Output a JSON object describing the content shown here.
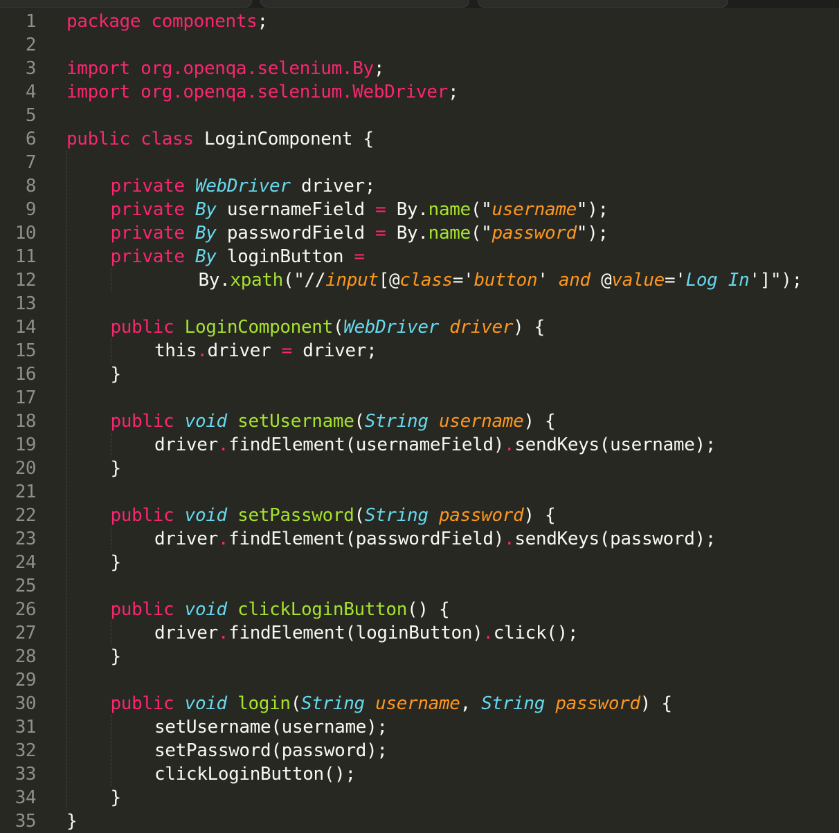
{
  "colors": {
    "background": "#272822",
    "default": "#f8f8f2",
    "keyword": "#f92672",
    "type": "#66d9ef",
    "function": "#a6e22e",
    "string": "#e6db74",
    "parameter": "#fd971f",
    "line_number": "#8f908a"
  },
  "editor": {
    "lines": [
      {
        "n": "1",
        "indent": 0,
        "tokens": [
          {
            "t": "package",
            "c": "keyword"
          },
          {
            "t": " ",
            "c": "default"
          },
          {
            "t": "components",
            "c": "keyword"
          },
          {
            "t": ";",
            "c": "default"
          }
        ]
      },
      {
        "n": "2",
        "indent": 0,
        "tokens": []
      },
      {
        "n": "3",
        "indent": 0,
        "tokens": [
          {
            "t": "import",
            "c": "keyword"
          },
          {
            "t": " ",
            "c": "default"
          },
          {
            "t": "org.openqa.selenium.By",
            "c": "keyword"
          },
          {
            "t": ";",
            "c": "default"
          }
        ]
      },
      {
        "n": "4",
        "indent": 0,
        "tokens": [
          {
            "t": "import",
            "c": "keyword"
          },
          {
            "t": " ",
            "c": "default"
          },
          {
            "t": "org.openqa.selenium.WebDriver",
            "c": "keyword"
          },
          {
            "t": ";",
            "c": "default"
          }
        ]
      },
      {
        "n": "5",
        "indent": 0,
        "tokens": []
      },
      {
        "n": "6",
        "indent": 0,
        "tokens": [
          {
            "t": "public",
            "c": "keyword"
          },
          {
            "t": " ",
            "c": "default"
          },
          {
            "t": "class",
            "c": "keyword"
          },
          {
            "t": " LoginComponent {",
            "c": "default"
          }
        ]
      },
      {
        "n": "7",
        "indent": 0,
        "tokens": []
      },
      {
        "n": "8",
        "indent": 1,
        "tokens": [
          {
            "t": "private",
            "c": "keyword"
          },
          {
            "t": " ",
            "c": "default"
          },
          {
            "t": "WebDriver",
            "c": "type",
            "i": true
          },
          {
            "t": " driver;",
            "c": "default"
          }
        ]
      },
      {
        "n": "9",
        "indent": 1,
        "tokens": [
          {
            "t": "private",
            "c": "keyword"
          },
          {
            "t": " ",
            "c": "default"
          },
          {
            "t": "By",
            "c": "type",
            "i": true
          },
          {
            "t": " usernameField ",
            "c": "default"
          },
          {
            "t": "=",
            "c": "keyword"
          },
          {
            "t": " By.",
            "c": "default"
          },
          {
            "t": "name",
            "c": "function"
          },
          {
            "t": "(\"",
            "c": "default"
          },
          {
            "t": "username",
            "c": "parameter",
            "i": true
          },
          {
            "t": "\");",
            "c": "default"
          }
        ]
      },
      {
        "n": "10",
        "indent": 1,
        "tokens": [
          {
            "t": "private",
            "c": "keyword"
          },
          {
            "t": " ",
            "c": "default"
          },
          {
            "t": "By",
            "c": "type",
            "i": true
          },
          {
            "t": " passwordField ",
            "c": "default"
          },
          {
            "t": "=",
            "c": "keyword"
          },
          {
            "t": " By.",
            "c": "default"
          },
          {
            "t": "name",
            "c": "function"
          },
          {
            "t": "(\"",
            "c": "default"
          },
          {
            "t": "password",
            "c": "parameter",
            "i": true
          },
          {
            "t": "\");",
            "c": "default"
          }
        ]
      },
      {
        "n": "11",
        "indent": 1,
        "tokens": [
          {
            "t": "private",
            "c": "keyword"
          },
          {
            "t": " ",
            "c": "default"
          },
          {
            "t": "By",
            "c": "type",
            "i": true
          },
          {
            "t": " loginButton ",
            "c": "default"
          },
          {
            "t": "=",
            "c": "keyword"
          }
        ]
      },
      {
        "n": "12",
        "indent": 3,
        "tokens": [
          {
            "t": "By.",
            "c": "default"
          },
          {
            "t": "xpath",
            "c": "function"
          },
          {
            "t": "(\"//",
            "c": "default"
          },
          {
            "t": "input",
            "c": "parameter",
            "i": true
          },
          {
            "t": "[@",
            "c": "default"
          },
          {
            "t": "class",
            "c": "parameter",
            "i": true
          },
          {
            "t": "='",
            "c": "default"
          },
          {
            "t": "button",
            "c": "parameter",
            "i": true
          },
          {
            "t": "' ",
            "c": "default"
          },
          {
            "t": "and",
            "c": "parameter",
            "i": true
          },
          {
            "t": " @",
            "c": "default"
          },
          {
            "t": "value",
            "c": "parameter",
            "i": true
          },
          {
            "t": "='",
            "c": "default"
          },
          {
            "t": "Log In",
            "c": "type",
            "i": true
          },
          {
            "t": "']\");",
            "c": "default"
          }
        ]
      },
      {
        "n": "13",
        "indent": 0,
        "tokens": []
      },
      {
        "n": "14",
        "indent": 1,
        "tokens": [
          {
            "t": "public",
            "c": "keyword"
          },
          {
            "t": " ",
            "c": "default"
          },
          {
            "t": "LoginComponent",
            "c": "function"
          },
          {
            "t": "(",
            "c": "default"
          },
          {
            "t": "WebDriver",
            "c": "type",
            "i": true
          },
          {
            "t": " ",
            "c": "default"
          },
          {
            "t": "driver",
            "c": "parameter",
            "i": true
          },
          {
            "t": ") {",
            "c": "default"
          }
        ]
      },
      {
        "n": "15",
        "indent": 2,
        "tokens": [
          {
            "t": "this",
            "c": "default"
          },
          {
            "t": ".",
            "c": "keyword"
          },
          {
            "t": "driver ",
            "c": "default"
          },
          {
            "t": "=",
            "c": "keyword"
          },
          {
            "t": " driver;",
            "c": "default"
          }
        ]
      },
      {
        "n": "16",
        "indent": 1,
        "tokens": [
          {
            "t": "}",
            "c": "default"
          }
        ]
      },
      {
        "n": "17",
        "indent": 0,
        "tokens": []
      },
      {
        "n": "18",
        "indent": 1,
        "tokens": [
          {
            "t": "public",
            "c": "keyword"
          },
          {
            "t": " ",
            "c": "default"
          },
          {
            "t": "void",
            "c": "type",
            "i": true
          },
          {
            "t": " ",
            "c": "default"
          },
          {
            "t": "setUsername",
            "c": "function"
          },
          {
            "t": "(",
            "c": "default"
          },
          {
            "t": "String",
            "c": "type",
            "i": true
          },
          {
            "t": " ",
            "c": "default"
          },
          {
            "t": "username",
            "c": "parameter",
            "i": true
          },
          {
            "t": ") {",
            "c": "default"
          }
        ]
      },
      {
        "n": "19",
        "indent": 2,
        "tokens": [
          {
            "t": "driver",
            "c": "default"
          },
          {
            "t": ".",
            "c": "keyword"
          },
          {
            "t": "findElement(usernameField)",
            "c": "default"
          },
          {
            "t": ".",
            "c": "keyword"
          },
          {
            "t": "sendKeys(username);",
            "c": "default"
          }
        ]
      },
      {
        "n": "20",
        "indent": 1,
        "tokens": [
          {
            "t": "}",
            "c": "default"
          }
        ]
      },
      {
        "n": "21",
        "indent": 0,
        "tokens": []
      },
      {
        "n": "22",
        "indent": 1,
        "tokens": [
          {
            "t": "public",
            "c": "keyword"
          },
          {
            "t": " ",
            "c": "default"
          },
          {
            "t": "void",
            "c": "type",
            "i": true
          },
          {
            "t": " ",
            "c": "default"
          },
          {
            "t": "setPassword",
            "c": "function"
          },
          {
            "t": "(",
            "c": "default"
          },
          {
            "t": "String",
            "c": "type",
            "i": true
          },
          {
            "t": " ",
            "c": "default"
          },
          {
            "t": "password",
            "c": "parameter",
            "i": true
          },
          {
            "t": ") {",
            "c": "default"
          }
        ]
      },
      {
        "n": "23",
        "indent": 2,
        "tokens": [
          {
            "t": "driver",
            "c": "default"
          },
          {
            "t": ".",
            "c": "keyword"
          },
          {
            "t": "findElement(passwordField)",
            "c": "default"
          },
          {
            "t": ".",
            "c": "keyword"
          },
          {
            "t": "sendKeys(password);",
            "c": "default"
          }
        ]
      },
      {
        "n": "24",
        "indent": 1,
        "tokens": [
          {
            "t": "}",
            "c": "default"
          }
        ]
      },
      {
        "n": "25",
        "indent": 0,
        "tokens": []
      },
      {
        "n": "26",
        "indent": 1,
        "tokens": [
          {
            "t": "public",
            "c": "keyword"
          },
          {
            "t": " ",
            "c": "default"
          },
          {
            "t": "void",
            "c": "type",
            "i": true
          },
          {
            "t": " ",
            "c": "default"
          },
          {
            "t": "clickLoginButton",
            "c": "function"
          },
          {
            "t": "() {",
            "c": "default"
          }
        ]
      },
      {
        "n": "27",
        "indent": 2,
        "tokens": [
          {
            "t": "driver",
            "c": "default"
          },
          {
            "t": ".",
            "c": "keyword"
          },
          {
            "t": "findElement(loginButton)",
            "c": "default"
          },
          {
            "t": ".",
            "c": "keyword"
          },
          {
            "t": "click();",
            "c": "default"
          }
        ]
      },
      {
        "n": "28",
        "indent": 1,
        "tokens": [
          {
            "t": "}",
            "c": "default"
          }
        ]
      },
      {
        "n": "29",
        "indent": 0,
        "tokens": []
      },
      {
        "n": "30",
        "indent": 1,
        "tokens": [
          {
            "t": "public",
            "c": "keyword"
          },
          {
            "t": " ",
            "c": "default"
          },
          {
            "t": "void",
            "c": "type",
            "i": true
          },
          {
            "t": " ",
            "c": "default"
          },
          {
            "t": "login",
            "c": "function"
          },
          {
            "t": "(",
            "c": "default"
          },
          {
            "t": "String",
            "c": "type",
            "i": true
          },
          {
            "t": " ",
            "c": "default"
          },
          {
            "t": "username",
            "c": "parameter",
            "i": true
          },
          {
            "t": ", ",
            "c": "default"
          },
          {
            "t": "String",
            "c": "type",
            "i": true
          },
          {
            "t": " ",
            "c": "default"
          },
          {
            "t": "password",
            "c": "parameter",
            "i": true
          },
          {
            "t": ") {",
            "c": "default"
          }
        ]
      },
      {
        "n": "31",
        "indent": 2,
        "tokens": [
          {
            "t": "setUsername(username);",
            "c": "default"
          }
        ]
      },
      {
        "n": "32",
        "indent": 2,
        "tokens": [
          {
            "t": "setPassword(password);",
            "c": "default"
          }
        ]
      },
      {
        "n": "33",
        "indent": 2,
        "tokens": [
          {
            "t": "clickLoginButton();",
            "c": "default"
          }
        ]
      },
      {
        "n": "34",
        "indent": 1,
        "tokens": [
          {
            "t": "}",
            "c": "default"
          }
        ]
      },
      {
        "n": "35",
        "indent": 0,
        "tokens": [
          {
            "t": "}",
            "c": "default"
          }
        ]
      }
    ]
  }
}
